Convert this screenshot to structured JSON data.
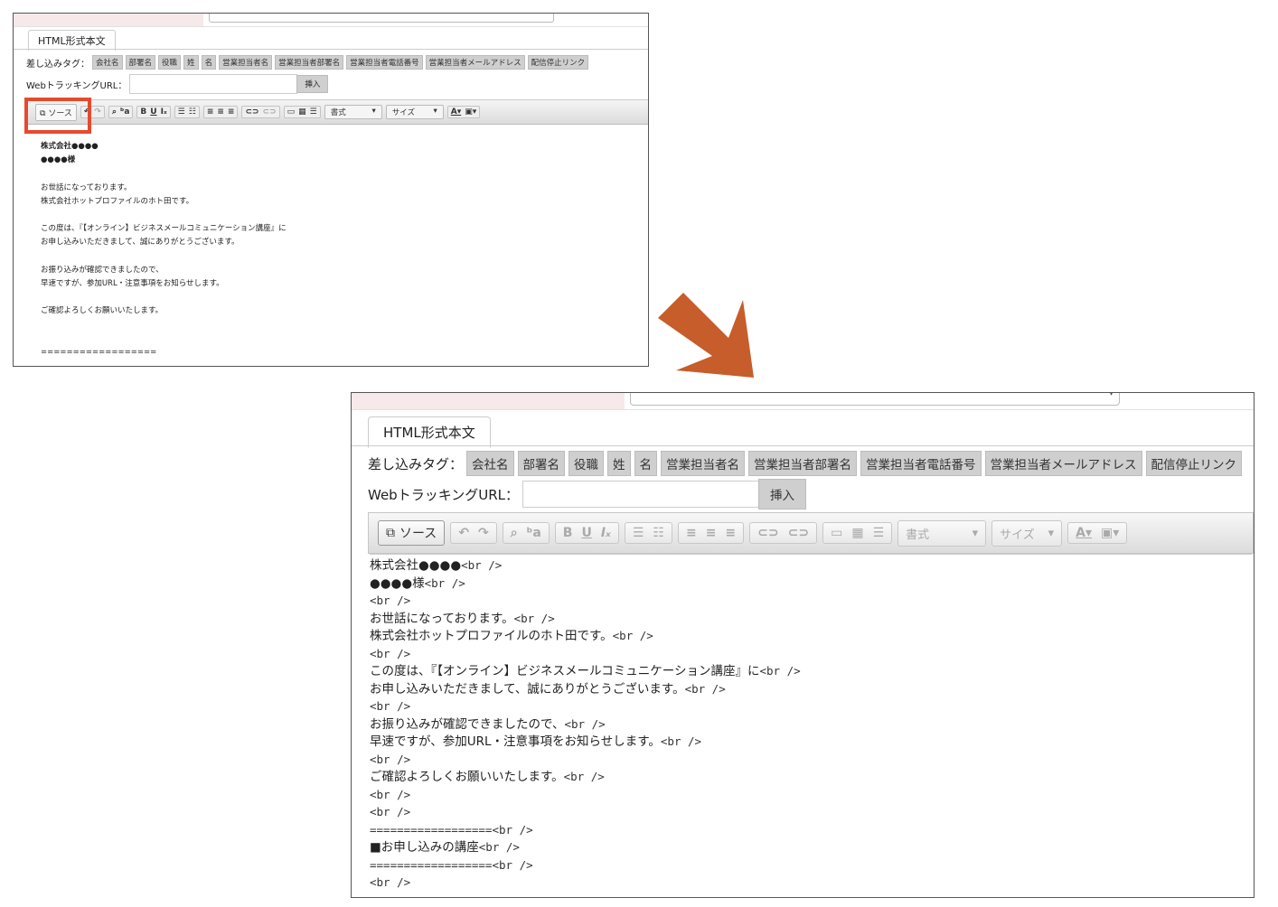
{
  "shot1": {
    "tab_label": "HTML形式本文",
    "merge_tags_label": "差し込みタグ：",
    "merge_tags": [
      "会社名",
      "部署名",
      "役職",
      "姓",
      "名",
      "営業担当者名",
      "営業担当者部署名",
      "営業担当者電話番号",
      "営業担当者メールアドレス",
      "配信停止リンク"
    ],
    "tracking_label": "WebトラッキングURL：",
    "insert_label": "挿入",
    "source_label": "ソース",
    "format_label": "書式",
    "size_label": "サイズ",
    "body_lines": [
      "株式会社●●●●",
      "●●●●様",
      "",
      "お世話になっております。",
      "株式会社ホットプロファイルのホト田です。",
      "",
      "この度は、『【オンライン】ビジネスメールコミュニケーション講座』に",
      "お申し込みいただきまして、誠にありがとうございます。",
      "",
      "お振り込みが確認できましたので、",
      "早速ですが、参加URL・注意事項をお知らせします。",
      "",
      "ご確認よろしくお願いいたします。",
      "",
      "",
      "=================="
    ]
  },
  "shot2": {
    "tab_label": "HTML形式本文",
    "merge_tags_label": "差し込みタグ：",
    "merge_tags": [
      "会社名",
      "部署名",
      "役職",
      "姓",
      "名",
      "営業担当者名",
      "営業担当者部署名",
      "営業担当者電話番号",
      "営業担当者メールアドレス",
      "配信停止リンク"
    ],
    "tracking_label": "WebトラッキングURL：",
    "insert_label": "挿入",
    "source_label": "ソース",
    "format_label": "書式",
    "size_label": "サイズ",
    "source_lines": [
      {
        "text": "株式会社●●●●",
        "tag": "<br />"
      },
      {
        "text": "●●●●様",
        "tag": "<br />"
      },
      {
        "text": "",
        "tag": "<br />"
      },
      {
        "text": "お世話になっております。",
        "tag": "<br />"
      },
      {
        "text": "株式会社ホットプロファイルのホト田です。",
        "tag": "<br />"
      },
      {
        "text": "",
        "tag": "<br />"
      },
      {
        "text": "この度は、『【オンライン】ビジネスメールコミュニケーション講座』に",
        "tag": "<br />"
      },
      {
        "text": "お申し込みいただきまして、誠にありがとうございます。",
        "tag": "<br />"
      },
      {
        "text": "",
        "tag": "<br />"
      },
      {
        "text": "お振り込みが確認できましたので、",
        "tag": "<br />"
      },
      {
        "text": "早速ですが、参加URL・注意事項をお知らせします。",
        "tag": "<br />"
      },
      {
        "text": "",
        "tag": "<br />"
      },
      {
        "text": "ご確認よろしくお願いいたします。",
        "tag": "<br />"
      },
      {
        "text": "",
        "tag": "<br />"
      },
      {
        "text": "",
        "tag": "<br />"
      },
      {
        "text": "==================",
        "tag": "<br />"
      },
      {
        "text": "■お申し込みの講座",
        "tag": "<br />"
      },
      {
        "text": "==================",
        "tag": "<br />"
      },
      {
        "text": "",
        "tag": "<br />"
      }
    ]
  },
  "colors": {
    "highlight": "#e64a2e",
    "arrow": "#c65d2a",
    "tag_bg": "#cfcfcf"
  }
}
